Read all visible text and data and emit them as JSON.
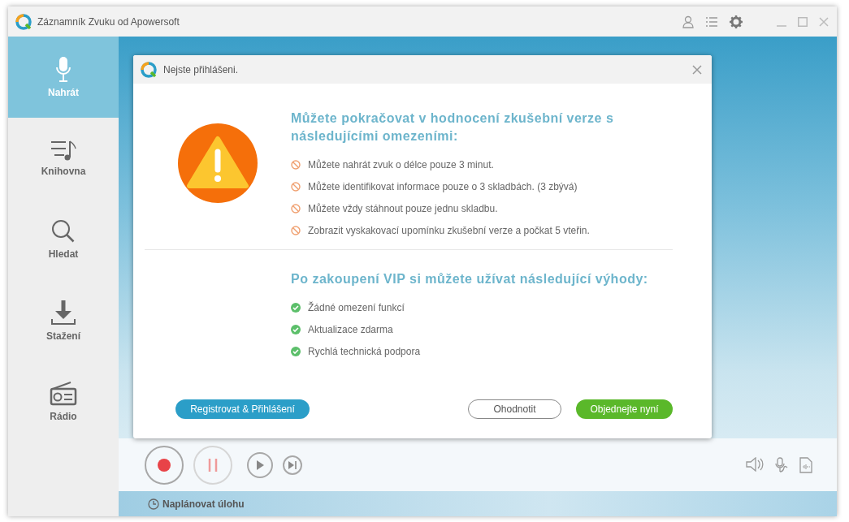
{
  "window": {
    "title": "Záznamník Zvuku od Apowersoft"
  },
  "sidebar": {
    "items": [
      {
        "label": "Nahrát",
        "selected": true
      },
      {
        "label": "Knihovna",
        "selected": false
      },
      {
        "label": "Hledat",
        "selected": false
      },
      {
        "label": "Stažení",
        "selected": false
      },
      {
        "label": "Rádio",
        "selected": false
      }
    ]
  },
  "dialog": {
    "title": "Nejste přihlášeni.",
    "limits_heading": "Můžete pokračovat v hodnocení zkušební verze s následujícími omezeními:",
    "limits": [
      "Můžete nahrát zvuk o délce pouze 3 minut.",
      "Můžete identifikovat informace pouze o 3 skladbách. (3 zbývá)",
      "Můžete vždy stáhnout pouze jednu skladbu.",
      "Zobrazit vyskakovací upomínku zkušební verze a počkat 5 vteřin."
    ],
    "benefits_heading": "Po zakoupení VIP si můžete užívat následující výhody:",
    "benefits": [
      "Žádné omezení funkcí",
      "Aktualizace zdarma",
      "Rychlá technická podpora"
    ],
    "buttons": [
      {
        "label": "Registrovat & Přihlášení",
        "kind": "primary"
      },
      {
        "label": "Ohodnotit",
        "kind": "outline"
      },
      {
        "label": "Objednejte nyní",
        "kind": "success"
      }
    ]
  },
  "status_bar": {
    "schedule": "Naplánovat úlohu"
  }
}
